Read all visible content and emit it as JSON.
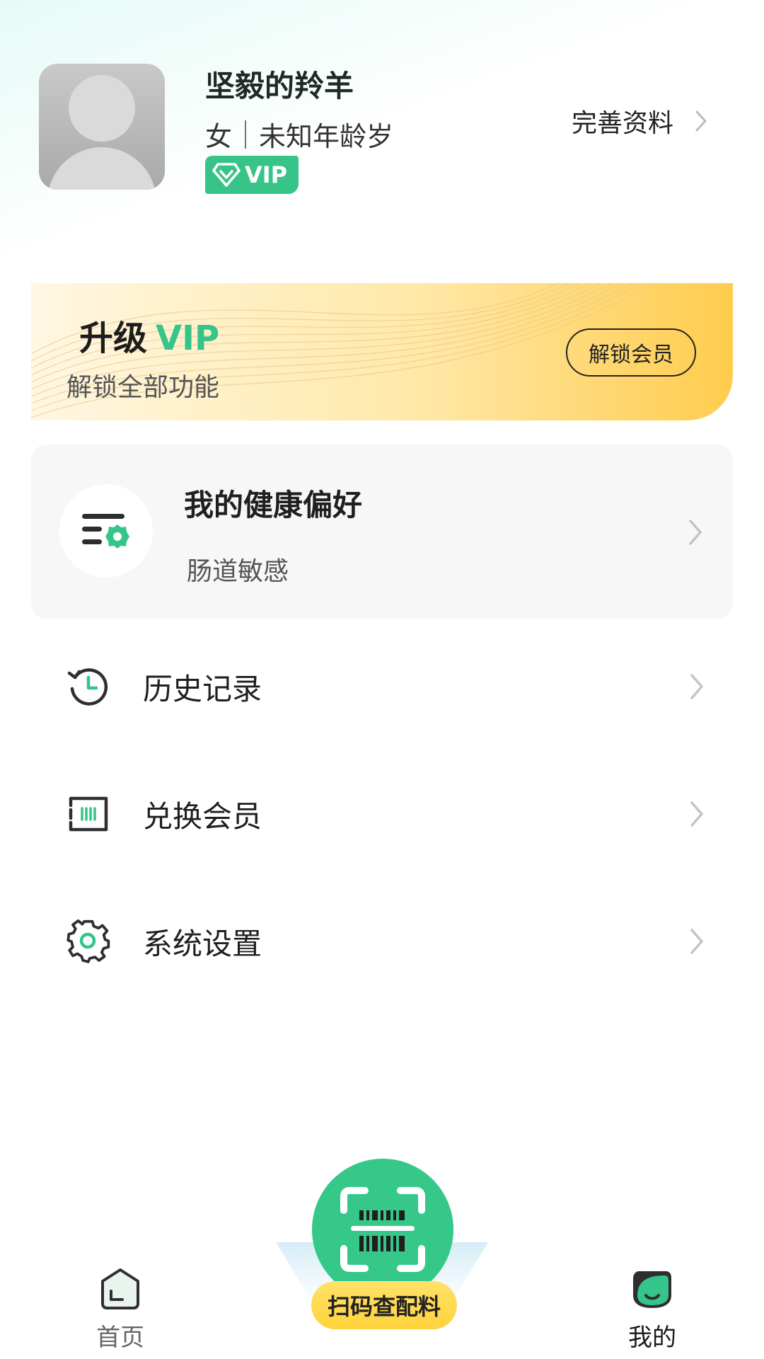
{
  "profile": {
    "nickname": "坚毅的羚羊",
    "gender": "女",
    "age": "未知年龄岁",
    "vip_badge": "VIP",
    "complete_profile": "完善资料"
  },
  "vip_banner": {
    "title_prefix": "升级",
    "title_accent": "VIP",
    "subtitle": "解锁全部功能",
    "button_label": "解锁会员"
  },
  "health": {
    "title": "我的健康偏好",
    "value": "肠道敏感"
  },
  "menu": {
    "history": "历史记录",
    "redeem": "兑换会员",
    "settings": "系统设置"
  },
  "nav": {
    "home": "首页",
    "scan": "扫码查配料",
    "mine": "我的"
  },
  "colors": {
    "accent": "#35c48a",
    "banner_gold": "#ffcc4d",
    "scan_label": "#ffd23a"
  }
}
